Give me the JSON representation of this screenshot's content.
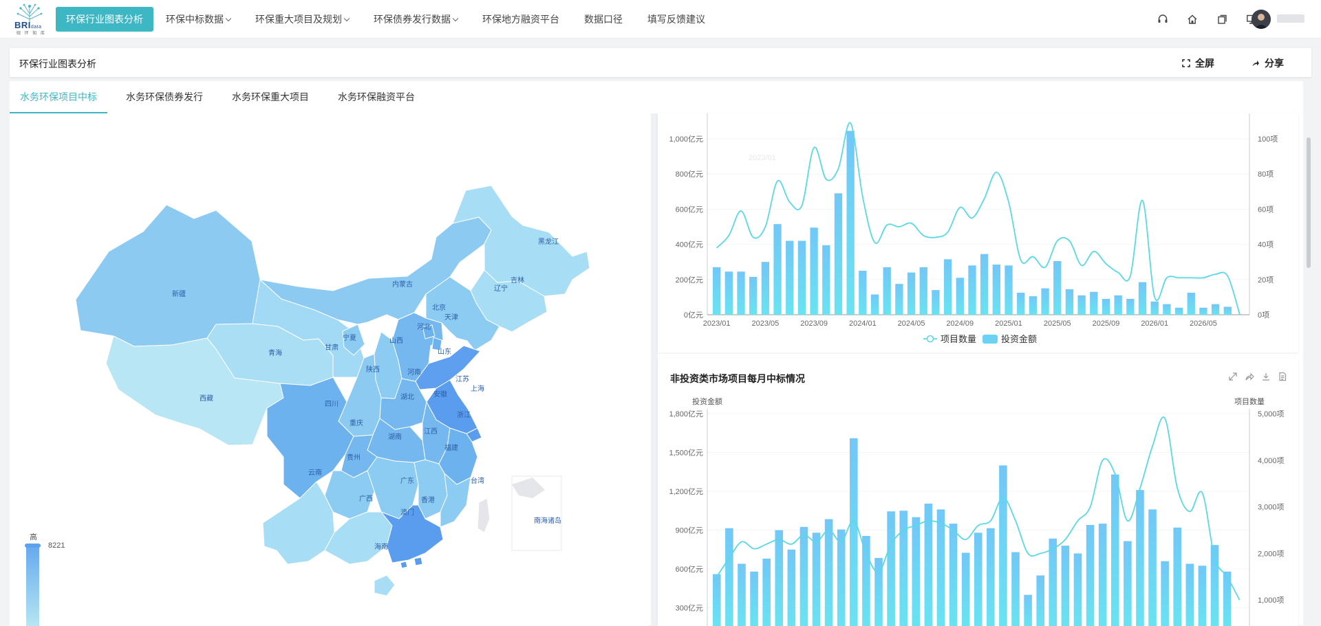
{
  "brand": {
    "logo_text": "BRI",
    "logo_small": "data",
    "logo_sub": "砚 环 知 库"
  },
  "nav": [
    {
      "label": "环保行业图表分析",
      "active": true,
      "dropdown": false
    },
    {
      "label": "环保中标数据",
      "dropdown": true
    },
    {
      "label": "环保重大项目及规划",
      "dropdown": true
    },
    {
      "label": "环保债券发行数据",
      "dropdown": true
    },
    {
      "label": "环保地方融资平台",
      "dropdown": false
    },
    {
      "label": "数据口径",
      "dropdown": false
    },
    {
      "label": "填写反馈建议",
      "dropdown": false
    }
  ],
  "top_icons": [
    "headset-icon",
    "home-icon",
    "copy-icon",
    "monitor-icon"
  ],
  "page": {
    "title": "环保行业图表分析",
    "fullscreen": "全屏",
    "share": "分享"
  },
  "tabs": [
    "水务环保项目中标",
    "水务环保债券发行",
    "水务环保重大项目",
    "水务环保融资平台"
  ],
  "map": {
    "legend_high": "高",
    "legend_max": "8221",
    "inset_label": "南海诸岛",
    "provinces": [
      "新疆",
      "西藏",
      "青海",
      "甘肃",
      "宁夏",
      "内蒙古",
      "黑龙江",
      "吉林",
      "辽宁",
      "北京",
      "天津",
      "河北",
      "山西",
      "陕西",
      "四川",
      "重庆",
      "云南",
      "贵州",
      "广西",
      "广东",
      "湖南",
      "湖北",
      "河南",
      "山东",
      "江苏",
      "安徽",
      "上海",
      "浙江",
      "江西",
      "福建",
      "台湾",
      "海南",
      "香港",
      "澳门"
    ]
  },
  "chart_data": [
    {
      "type": "bar",
      "title": "",
      "categories": [
        "2023/01",
        "2023/02",
        "2023/03",
        "2023/04",
        "2023/05",
        "2023/06",
        "2023/07",
        "2023/08",
        "2023/09",
        "2023/10",
        "2023/11",
        "2023/12",
        "2024/01",
        "2024/02",
        "2024/03",
        "2024/04",
        "2024/05",
        "2024/06",
        "2024/07",
        "2024/08",
        "2024/09",
        "2024/10",
        "2024/11",
        "2024/12",
        "2025/01",
        "2025/02",
        "2025/03",
        "2025/04",
        "2025/05",
        "2025/06",
        "2025/07",
        "2025/08",
        "2025/09",
        "2025/10",
        "2025/11",
        "2025/12",
        "2026/01",
        "2026/02",
        "2026/03",
        "2026/04",
        "2026/05",
        "2026/06",
        "2026/07",
        "2026/08"
      ],
      "x_tick_labels": [
        "2023/01",
        "2023/05",
        "2023/09",
        "2024/01",
        "2024/05",
        "2024/09",
        "2025/01",
        "2025/05",
        "2025/09",
        "2026/01",
        "2026/05"
      ],
      "series": [
        {
          "name": "投资金额",
          "values": [
            270,
            245,
            245,
            215,
            300,
            515,
            420,
            420,
            495,
            395,
            690,
            1045,
            250,
            115,
            270,
            175,
            240,
            270,
            140,
            315,
            210,
            280,
            345,
            285,
            280,
            125,
            105,
            150,
            305,
            145,
            110,
            130,
            90,
            110,
            90,
            185,
            75,
            60,
            40,
            125,
            40,
            60,
            45,
            0
          ]
        },
        {
          "name": "项目数量",
          "values": [
            38,
            45,
            59,
            44,
            50,
            76,
            64,
            62,
            95,
            77,
            83,
            109,
            67,
            41,
            51,
            50,
            52,
            45,
            44,
            47,
            61,
            55,
            66,
            81,
            64,
            31,
            33,
            27,
            42,
            42,
            28,
            36,
            29,
            24,
            22,
            65,
            10,
            21,
            21,
            21,
            21,
            23,
            22,
            0
          ]
        }
      ],
      "y_left_ticks": [
        "0亿元",
        "200亿元",
        "400亿元",
        "600亿元",
        "800亿元",
        "1,000亿元"
      ],
      "y_right_ticks": [
        "0项",
        "20项",
        "40项",
        "60项",
        "80项",
        "100项"
      ],
      "ylim_left": [
        0,
        1000
      ],
      "ylim_right": [
        0,
        100
      ],
      "tooltip_ghost": "2023/01"
    },
    {
      "type": "bar",
      "title": "非投资类市场项目每月中标情况",
      "ylabel_left": "投资金额",
      "ylabel_right": "项目数量",
      "y_left_ticks": [
        "300亿元",
        "600亿元",
        "900亿元",
        "1,200亿元",
        "1,500亿元",
        "1,800亿元"
      ],
      "y_right_ticks": [
        "1,000项",
        "2,000项",
        "3,000项",
        "4,000项",
        "5,000项"
      ],
      "ylim_left": [
        0,
        1800
      ],
      "ylim_right": [
        0,
        5000
      ],
      "series": [
        {
          "name": "投资金额",
          "values": [
            560,
            915,
            640,
            580,
            680,
            900,
            750,
            925,
            880,
            985,
            905,
            1610,
            855,
            685,
            1045,
            1050,
            1000,
            1105,
            1060,
            950,
            725,
            880,
            915,
            1400,
            730,
            400,
            550,
            835,
            780,
            720,
            940,
            950,
            1330,
            815,
            1210,
            1060,
            660,
            920,
            640,
            625,
            785,
            580,
            0
          ]
        },
        {
          "name": "项目数量",
          "values": [
            1500,
            1900,
            2250,
            2100,
            2200,
            2300,
            2200,
            2400,
            2250,
            2500,
            2250,
            2700,
            2000,
            1600,
            2200,
            2500,
            2600,
            2700,
            2650,
            2500,
            2300,
            2600,
            2700,
            3200,
            2700,
            2000,
            2000,
            2100,
            2300,
            2700,
            3000,
            4000,
            3700,
            2700,
            3400,
            4300,
            4900,
            3400,
            2900,
            3300,
            1900,
            1500,
            1000
          ]
        }
      ]
    }
  ],
  "legend": {
    "count": "项目数量",
    "amount": "投资金额"
  },
  "colors": {
    "accent": "#3eb7c5",
    "bar": "#69d2f4",
    "line": "#5ad6e4",
    "map_dark": "#5a9def",
    "map_light": "#b8e6f4"
  }
}
